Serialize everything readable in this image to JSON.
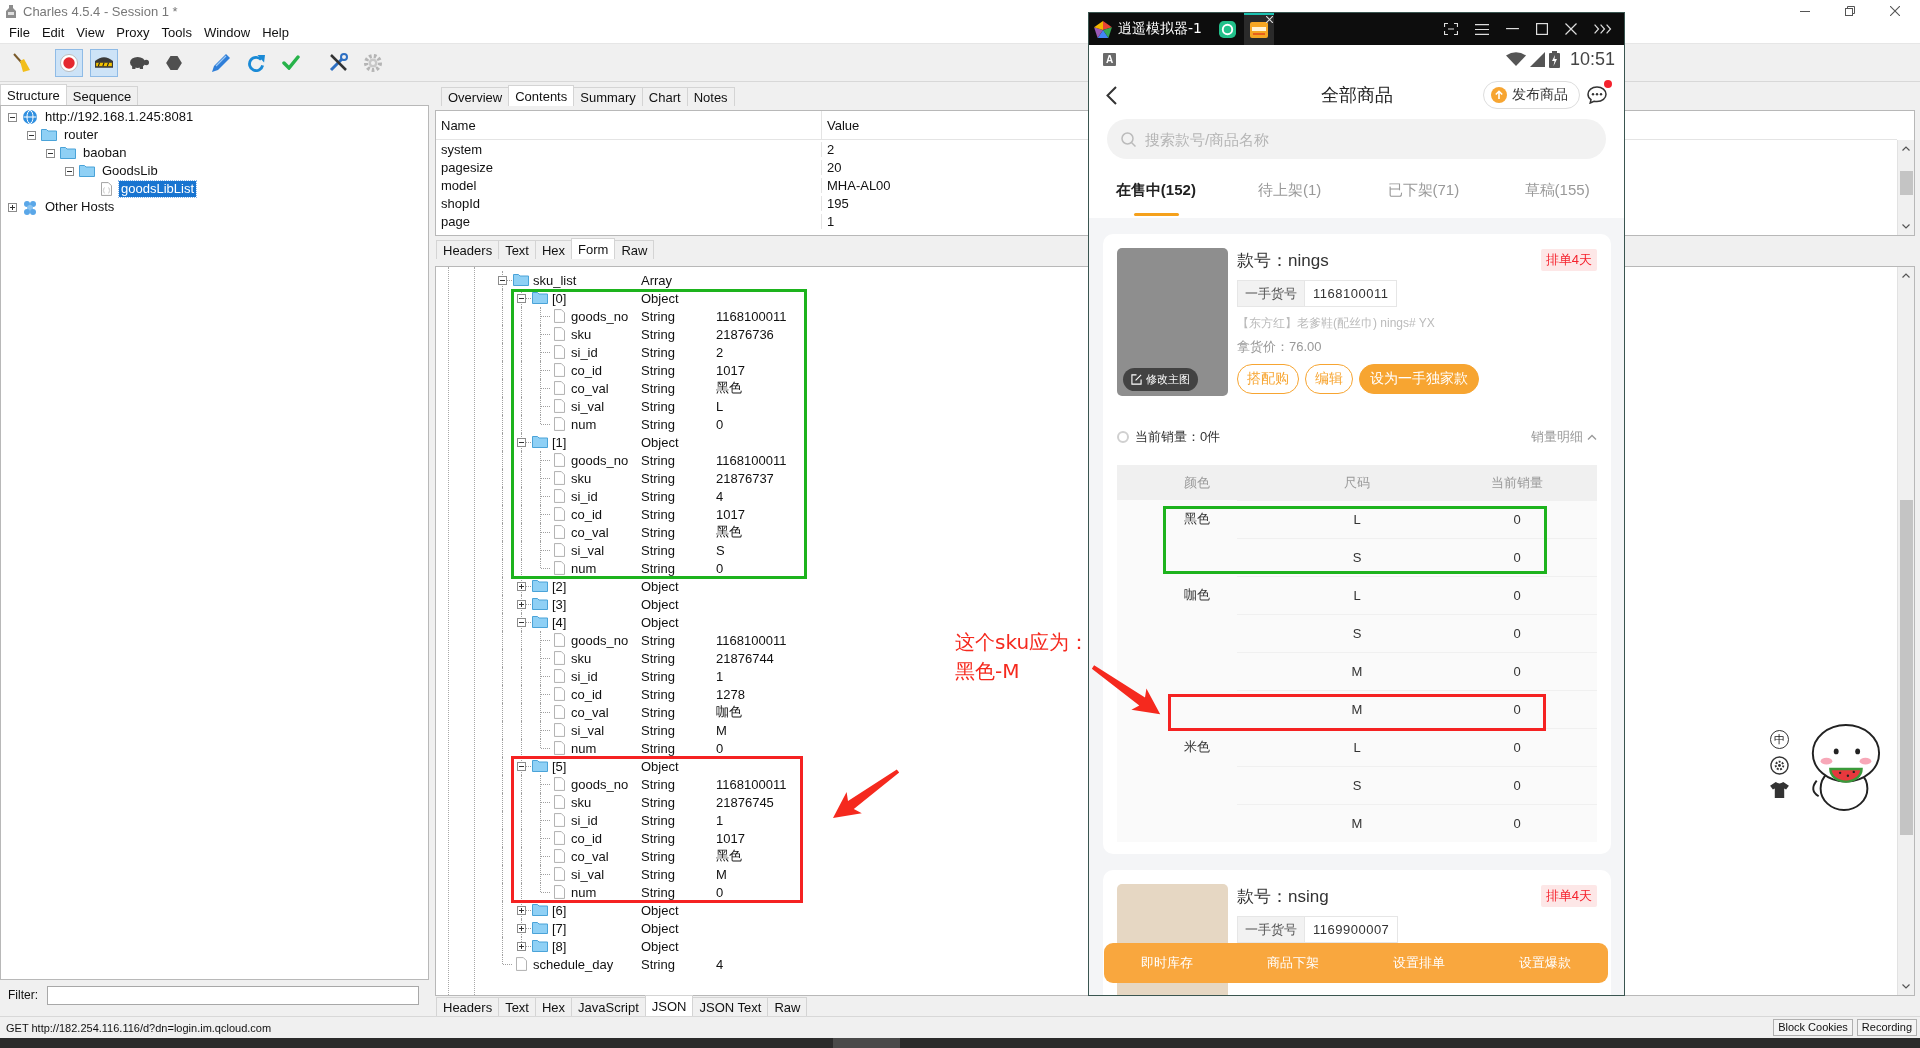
{
  "window": {
    "title": "Charles 4.5.4 - Session 1 *"
  },
  "menu": [
    "File",
    "Edit",
    "View",
    "Proxy",
    "Tools",
    "Window",
    "Help"
  ],
  "toolbar": [
    [
      {
        "kind": "broom",
        "pressed": false
      }
    ],
    [
      {
        "kind": "record",
        "pressed": true
      },
      {
        "kind": "throttle",
        "pressed": true
      },
      {
        "kind": "turtle",
        "pressed": false
      },
      {
        "kind": "stop",
        "pressed": false
      }
    ],
    [
      {
        "kind": "pen",
        "pressed": false
      },
      {
        "kind": "refresh",
        "pressed": false
      },
      {
        "kind": "check",
        "pressed": false
      }
    ],
    [
      {
        "kind": "tools",
        "pressed": false
      },
      {
        "kind": "gear",
        "pressed": false
      }
    ]
  ],
  "structure_panel": {
    "tabs": [
      {
        "label": "Structure",
        "selected": true
      },
      {
        "label": "Sequence",
        "selected": false
      }
    ],
    "tree": [
      {
        "label": "http://192.168.1.245:8081",
        "kind": "host",
        "expanded": true,
        "selected": false,
        "children": [
          {
            "label": "router",
            "kind": "folder",
            "expanded": true,
            "selected": false,
            "children": [
              {
                "label": "baoban",
                "kind": "folder",
                "expanded": true,
                "selected": false,
                "children": [
                  {
                    "label": "GoodsLib",
                    "kind": "folder",
                    "expanded": true,
                    "selected": false,
                    "children": [
                      {
                        "label": "goodsLibList",
                        "kind": "file",
                        "selected": true
                      }
                    ]
                  }
                ]
              }
            ]
          }
        ]
      },
      {
        "label": "Other Hosts",
        "kind": "hosts",
        "expanded": false,
        "selected": false
      }
    ],
    "filter": {
      "label": "Filter:"
    }
  },
  "detail_panel": {
    "tabs": [
      {
        "label": "Overview",
        "selected": false
      },
      {
        "label": "Contents",
        "selected": true
      },
      {
        "label": "Summary",
        "selected": false
      },
      {
        "label": "Chart",
        "selected": false
      },
      {
        "label": "Notes",
        "selected": false
      }
    ],
    "form_table": {
      "columns": [
        "Name",
        "Value"
      ],
      "rows": [
        [
          "system",
          "2"
        ],
        [
          "pagesize",
          "20"
        ],
        [
          "model",
          "MHA-AL00"
        ],
        [
          "shopId",
          "195"
        ],
        [
          "page",
          "1"
        ]
      ]
    },
    "request_tabs": [
      {
        "label": "Headers",
        "selected": false
      },
      {
        "label": "Text",
        "selected": false
      },
      {
        "label": "Hex",
        "selected": false
      },
      {
        "label": "Form",
        "selected": true
      },
      {
        "label": "Raw",
        "selected": false
      }
    ],
    "json_tree": [
      {
        "name": "sku_list",
        "type": "Array",
        "expanded": true,
        "children": [
          {
            "name": "[0]",
            "type": "Object",
            "expanded": true,
            "children": [
              {
                "name": "goods_no",
                "type": "String",
                "value": "1168100011"
              },
              {
                "name": "sku",
                "type": "String",
                "value": "21876736"
              },
              {
                "name": "si_id",
                "type": "String",
                "value": "2"
              },
              {
                "name": "co_id",
                "type": "String",
                "value": "1017"
              },
              {
                "name": "co_val",
                "type": "String",
                "value": "黑色"
              },
              {
                "name": "si_val",
                "type": "String",
                "value": "L"
              },
              {
                "name": "num",
                "type": "String",
                "value": "0"
              }
            ]
          },
          {
            "name": "[1]",
            "type": "Object",
            "expanded": true,
            "children": [
              {
                "name": "goods_no",
                "type": "String",
                "value": "1168100011"
              },
              {
                "name": "sku",
                "type": "String",
                "value": "21876737"
              },
              {
                "name": "si_id",
                "type": "String",
                "value": "4"
              },
              {
                "name": "co_id",
                "type": "String",
                "value": "1017"
              },
              {
                "name": "co_val",
                "type": "String",
                "value": "黑色"
              },
              {
                "name": "si_val",
                "type": "String",
                "value": "S"
              },
              {
                "name": "num",
                "type": "String",
                "value": "0"
              }
            ]
          },
          {
            "name": "[2]",
            "type": "Object",
            "expanded": false
          },
          {
            "name": "[3]",
            "type": "Object",
            "expanded": false
          },
          {
            "name": "[4]",
            "type": "Object",
            "expanded": true,
            "children": [
              {
                "name": "goods_no",
                "type": "String",
                "value": "1168100011"
              },
              {
                "name": "sku",
                "type": "String",
                "value": "21876744"
              },
              {
                "name": "si_id",
                "type": "String",
                "value": "1"
              },
              {
                "name": "co_id",
                "type": "String",
                "value": "1278"
              },
              {
                "name": "co_val",
                "type": "String",
                "value": "咖色"
              },
              {
                "name": "si_val",
                "type": "String",
                "value": "M"
              },
              {
                "name": "num",
                "type": "String",
                "value": "0"
              }
            ]
          },
          {
            "name": "[5]",
            "type": "Object",
            "expanded": true,
            "children": [
              {
                "name": "goods_no",
                "type": "String",
                "value": "1168100011"
              },
              {
                "name": "sku",
                "type": "String",
                "value": "21876745"
              },
              {
                "name": "si_id",
                "type": "String",
                "value": "1"
              },
              {
                "name": "co_id",
                "type": "String",
                "value": "1017"
              },
              {
                "name": "co_val",
                "type": "String",
                "value": "黑色"
              },
              {
                "name": "si_val",
                "type": "String",
                "value": "M"
              },
              {
                "name": "num",
                "type": "String",
                "value": "0"
              }
            ]
          },
          {
            "name": "[6]",
            "type": "Object",
            "expanded": false
          },
          {
            "name": "[7]",
            "type": "Object",
            "expanded": false
          },
          {
            "name": "[8]",
            "type": "Object",
            "expanded": false
          }
        ]
      },
      {
        "name": "schedule_day",
        "type": "String",
        "value": "4"
      }
    ],
    "response_tabs": [
      {
        "label": "Headers",
        "selected": false
      },
      {
        "label": "Text",
        "selected": false
      },
      {
        "label": "Hex",
        "selected": false
      },
      {
        "label": "JavaScript",
        "selected": false
      },
      {
        "label": "JSON",
        "selected": true
      },
      {
        "label": "JSON Text",
        "selected": false
      },
      {
        "label": "Raw",
        "selected": false
      }
    ]
  },
  "status_bar": {
    "text": "GET http://182.254.116.116/d?dn=login.im.qcloud.com",
    "buttons": [
      "Block Cookies",
      "Recording"
    ]
  },
  "emulator": {
    "title": "逍遥模拟器-1",
    "status_bar": {
      "notification": "A",
      "clock": "10:51"
    },
    "app": {
      "header": {
        "title": "全部商品",
        "publish_button": "发布商品",
        "unread": true
      },
      "search": {
        "placeholder": "搜索款号/商品名称"
      },
      "tabs": [
        {
          "label": "在售中(152)",
          "selected": true
        },
        {
          "label": "待上架(1)",
          "selected": false
        },
        {
          "label": "已下架(71)",
          "selected": false
        },
        {
          "label": "草稿(155)",
          "selected": false
        }
      ],
      "products": [
        {
          "style_no": "款号：nings",
          "badge": "排单4天",
          "code_label": "一手货号",
          "code": "1168100011",
          "name": "【东方红】老爹鞋(配丝巾) nings# YX",
          "price": "拿货价：76.00",
          "image_button": "修改主图",
          "actions": [
            {
              "label": "搭配购",
              "primary": false
            },
            {
              "label": "编辑",
              "primary": false
            },
            {
              "label": "设为一手独家款",
              "primary": true
            }
          ],
          "sales": {
            "label": "当前销量：0件",
            "detail_button": "销量明细",
            "expanded": true,
            "columns": [
              "颜色",
              "尺码",
              "当前销量"
            ],
            "groups": [
              {
                "name": "黑色",
                "sizes": [
                  {
                    "size": "L",
                    "sales": "0"
                  },
                  {
                    "size": "S",
                    "sales": "0"
                  }
                ]
              },
              {
                "name": "咖色",
                "sizes": [
                  {
                    "size": "L",
                    "sales": "0"
                  },
                  {
                    "size": "S",
                    "sales": "0"
                  },
                  {
                    "size": "M",
                    "sales": "0"
                  },
                  {
                    "size": "M",
                    "sales": "0"
                  }
                ]
              },
              {
                "name": "米色",
                "sizes": [
                  {
                    "size": "L",
                    "sales": "0"
                  },
                  {
                    "size": "S",
                    "sales": "0"
                  },
                  {
                    "size": "M",
                    "sales": "0"
                  }
                ]
              }
            ]
          }
        },
        {
          "style_no": "款号：nsing",
          "badge": "排单4天",
          "code_label": "一手货号",
          "code": "1169900007"
        }
      ],
      "bottom_actions": [
        "即时库存",
        "商品下架",
        "设置排单",
        "设置爆款"
      ]
    }
  },
  "ime_toolbar": {
    "mode": "中"
  },
  "annotations": {
    "boxes": [
      {
        "color": "#1db31d"
      },
      {
        "color": "#f52222"
      },
      {
        "color": "#1db31d"
      },
      {
        "color": "#f52222"
      }
    ],
    "note": [
      "这个sku应为：",
      "黑色-M"
    ]
  }
}
